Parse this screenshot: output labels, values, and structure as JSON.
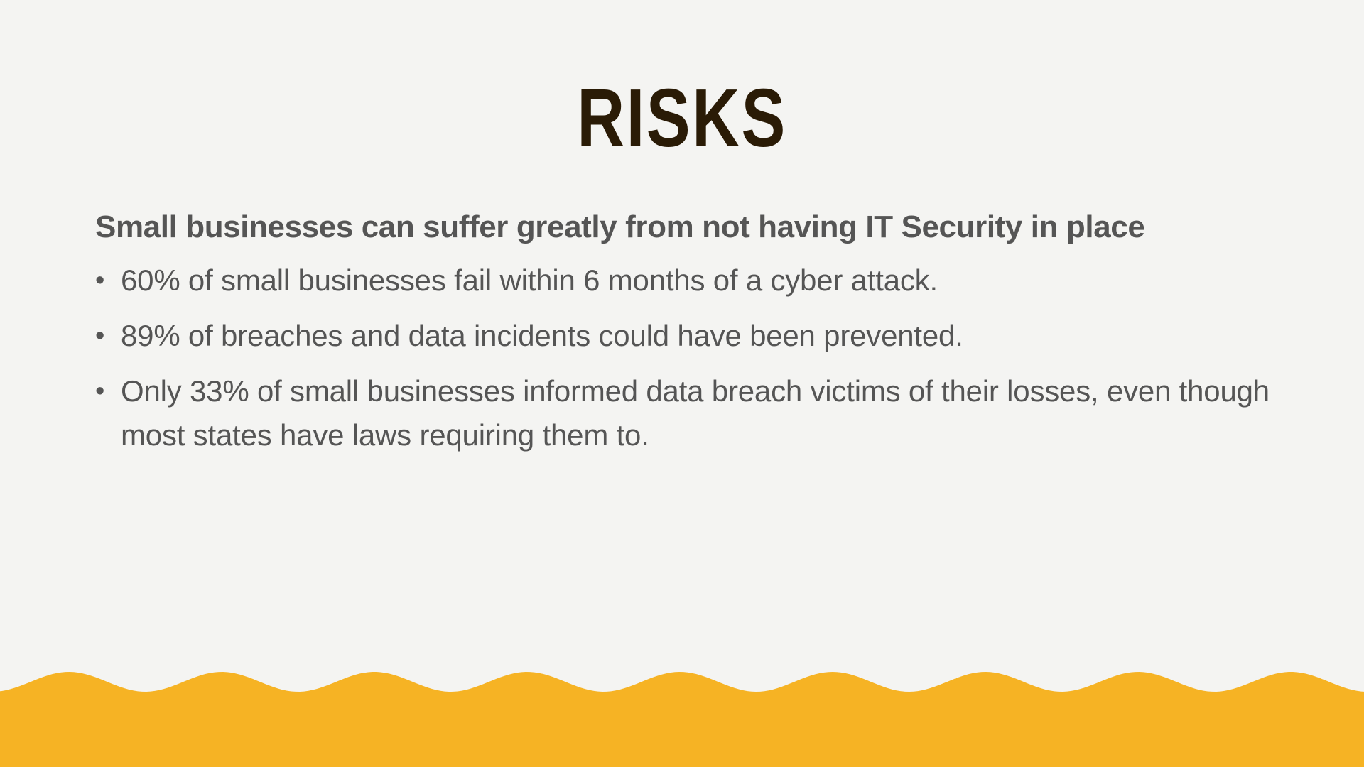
{
  "slide": {
    "title": "RISKS",
    "subheading": "Small businesses can suffer greatly from not having IT Security in place",
    "bullet_glyph": "•",
    "bullets": [
      "60% of small businesses fail within 6 months of a cyber attack.",
      "89% of breaches and data incidents could have been prevented.",
      "Only 33% of small businesses informed data breach victims of their losses, even though most states have laws requiring them to."
    ]
  },
  "colors": {
    "background": "#f4f4f2",
    "title": "#2a1b06",
    "body_text": "#555555",
    "wave_accent": "#f6b324"
  }
}
